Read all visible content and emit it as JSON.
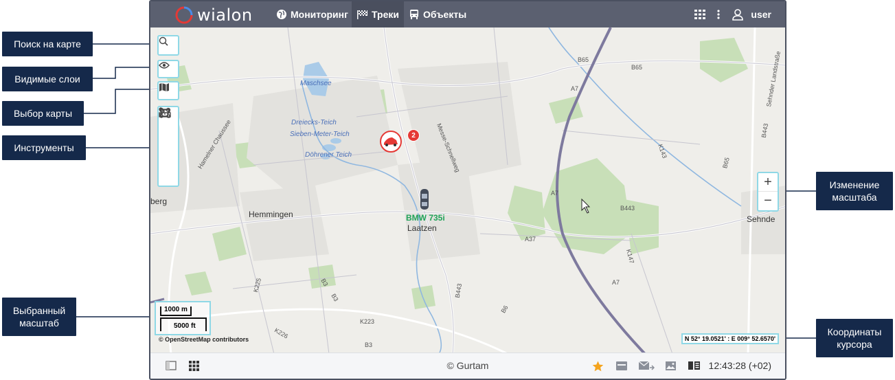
{
  "app": {
    "brand": "wialon"
  },
  "nav": [
    {
      "label": "Мониторинг",
      "icon": "globe-icon"
    },
    {
      "label": "Треки",
      "icon": "checkered-flag-icon"
    },
    {
      "label": "Объекты",
      "icon": "bus-icon"
    }
  ],
  "header_right": {
    "user": "user",
    "icons": [
      "apps-grid-icon",
      "more-vertical-icon",
      "user-icon"
    ]
  },
  "map": {
    "labels": {
      "maschsee": "Maschsee",
      "dreiecks": "Dreiecks-Teich",
      "sieben": "Sieben-Meter-Teich",
      "dohrener": "Döhrener Teich",
      "hemmingen": "Hemmingen",
      "laatzen": "Laatzen",
      "sehnde": "Sehnde",
      "berg": "berg",
      "hamelner": "Hamelner Chaussee",
      "messe": "Messe-Schnellweg",
      "sehnder_land": "Sehnder Landstraße"
    },
    "roads": {
      "b65a": "B65",
      "b65b": "B65",
      "b65c": "B65",
      "a7a": "A7",
      "a7b": "A7",
      "a7c": "A7",
      "b443a": "B443",
      "b443b": "B443",
      "b443c": "B443",
      "k143": "K143",
      "k147": "K147",
      "a37": "A37",
      "b3a": "B3",
      "b3b": "B3",
      "b3c": "B3",
      "k225": "K225",
      "k223": "K223",
      "k226": "K226",
      "b6": "B6"
    },
    "unit": {
      "name": "BMW 735i",
      "cluster_count": "2"
    },
    "scale": {
      "metric": "1000 m",
      "imperial": "5000 ft"
    },
    "attribution": "© OpenStreetMap contributors",
    "coordinates": "N 52° 19.0521' : E 009° 52.6570'",
    "zoom": {
      "in": "+",
      "out": "−"
    }
  },
  "footer": {
    "copyright": "© Gurtam",
    "time": "12:43:28 (+02)"
  },
  "callouts": {
    "search": "Поиск на карте",
    "layers": "Видимые слои",
    "map_select": "Выбор карты",
    "tools": "Инструменты",
    "selected_scale": "Выбранный масштаб",
    "zoom_change": "Изменение масштаба",
    "cursor_coords": "Координаты курсора"
  },
  "colors": {
    "topbar": "#5b6070",
    "callout": "#15294a",
    "highlight": "#8fd8e6",
    "unit_label": "#21a35a",
    "badge": "#e53935"
  }
}
